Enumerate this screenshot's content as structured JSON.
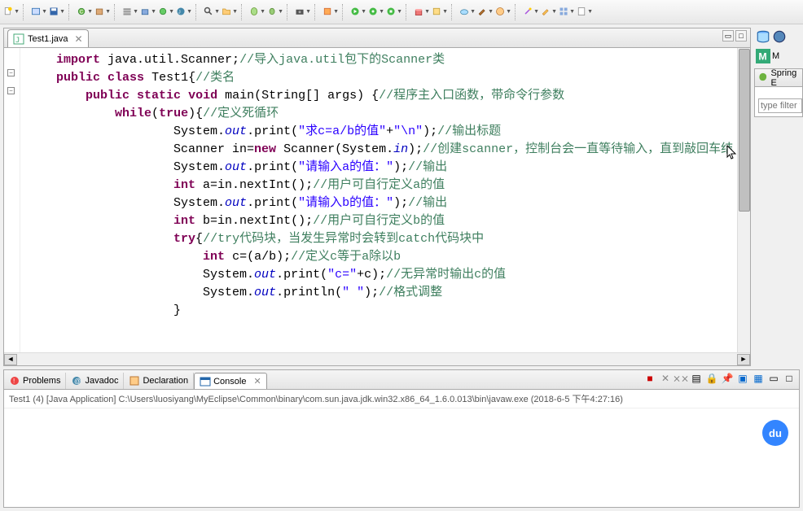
{
  "toolbar": {
    "groups": [
      [
        "new-icon"
      ],
      [
        "open-type-icon",
        "save-icon"
      ],
      [
        "new-class-icon",
        "new-package-icon"
      ],
      [
        "servers-icon",
        "deploy-icon",
        "publish-icon",
        "jsp-icon"
      ],
      [
        "search-icon",
        "folder-icon"
      ],
      [
        "new-bean-icon",
        "bean-icon"
      ],
      [
        "camera-icon"
      ],
      [
        "paint-icon"
      ],
      [
        "run-icon",
        "debug-icon",
        "external-icon"
      ],
      [
        "gift-icon",
        "task-icon"
      ],
      [
        "cloud-icon",
        "brush-icon",
        "palette-icon"
      ],
      [
        "wand-icon",
        "pencil-icon",
        "grid-icon",
        "doc-icon"
      ]
    ]
  },
  "editor": {
    "tab_label": "Test1.java",
    "tab_icon": "java-file-icon"
  },
  "code": {
    "lines": [
      {
        "indent": 1,
        "tokens": [
          {
            "t": "kw",
            "s": "import"
          },
          {
            "t": "p",
            "s": " java.util.Scanner;"
          },
          {
            "t": "com",
            "s": "//导入java.util包下的Scanner类"
          }
        ]
      },
      {
        "indent": 1,
        "tokens": [
          {
            "t": "kw",
            "s": "public"
          },
          {
            "t": "p",
            "s": " "
          },
          {
            "t": "kw",
            "s": "class"
          },
          {
            "t": "p",
            "s": " Test1{"
          },
          {
            "t": "com",
            "s": "//类名"
          }
        ]
      },
      {
        "indent": 2,
        "tokens": [
          {
            "t": "kw",
            "s": "public"
          },
          {
            "t": "p",
            "s": " "
          },
          {
            "t": "kw",
            "s": "static"
          },
          {
            "t": "p",
            "s": " "
          },
          {
            "t": "kw",
            "s": "void"
          },
          {
            "t": "p",
            "s": " main(String[] args) {"
          },
          {
            "t": "com",
            "s": "//程序主入口函数，带命令行参数"
          }
        ]
      },
      {
        "indent": 3,
        "tokens": [
          {
            "t": "kw",
            "s": "while"
          },
          {
            "t": "p",
            "s": "("
          },
          {
            "t": "kw",
            "s": "true"
          },
          {
            "t": "p",
            "s": "){"
          },
          {
            "t": "com",
            "s": "//定义死循环"
          }
        ]
      },
      {
        "indent": 5,
        "tokens": [
          {
            "t": "p",
            "s": "System."
          },
          {
            "t": "fld",
            "s": "out"
          },
          {
            "t": "p",
            "s": ".print("
          },
          {
            "t": "str",
            "s": "\"求c=a/b的值\""
          },
          {
            "t": "p",
            "s": "+"
          },
          {
            "t": "str",
            "s": "\"\\n\""
          },
          {
            "t": "p",
            "s": ");"
          },
          {
            "t": "com",
            "s": "//输出标题"
          }
        ]
      },
      {
        "indent": 5,
        "tokens": [
          {
            "t": "p",
            "s": "Scanner in="
          },
          {
            "t": "kw",
            "s": "new"
          },
          {
            "t": "p",
            "s": " Scanner(System."
          },
          {
            "t": "fld",
            "s": "in"
          },
          {
            "t": "p",
            "s": ");"
          },
          {
            "t": "com",
            "s": "//创建scanner，控制台会一直等待输入，直到敲回车结"
          }
        ]
      },
      {
        "indent": 5,
        "tokens": [
          {
            "t": "p",
            "s": "System."
          },
          {
            "t": "fld",
            "s": "out"
          },
          {
            "t": "p",
            "s": ".print("
          },
          {
            "t": "str",
            "s": "\"请输入a的值：\""
          },
          {
            "t": "p",
            "s": ");"
          },
          {
            "t": "com",
            "s": "//输出"
          }
        ]
      },
      {
        "indent": 5,
        "tokens": [
          {
            "t": "kw",
            "s": "int"
          },
          {
            "t": "p",
            "s": " a=in.nextInt();"
          },
          {
            "t": "com",
            "s": "//用户可自行定义a的值"
          }
        ]
      },
      {
        "indent": 5,
        "tokens": [
          {
            "t": "p",
            "s": "System."
          },
          {
            "t": "fld",
            "s": "out"
          },
          {
            "t": "p",
            "s": ".print("
          },
          {
            "t": "str",
            "s": "\"请输入b的值：\""
          },
          {
            "t": "p",
            "s": ");"
          },
          {
            "t": "com",
            "s": "//输出"
          }
        ]
      },
      {
        "indent": 5,
        "tokens": [
          {
            "t": "kw",
            "s": "int"
          },
          {
            "t": "p",
            "s": " b=in.nextInt();"
          },
          {
            "t": "com",
            "s": "//用户可自行定义b的值"
          }
        ]
      },
      {
        "indent": 5,
        "tokens": [
          {
            "t": "kw",
            "s": "try"
          },
          {
            "t": "p",
            "s": "{"
          },
          {
            "t": "com",
            "s": "//try代码块，当发生异常时会转到catch代码块中"
          }
        ]
      },
      {
        "indent": 6,
        "tokens": [
          {
            "t": "kw",
            "s": "int"
          },
          {
            "t": "p",
            "s": " c=(a/b);"
          },
          {
            "t": "com",
            "s": "//定义c等于a除以b"
          }
        ]
      },
      {
        "indent": 6,
        "tokens": [
          {
            "t": "p",
            "s": "System."
          },
          {
            "t": "fld",
            "s": "out"
          },
          {
            "t": "p",
            "s": ".print("
          },
          {
            "t": "str",
            "s": "\"c=\""
          },
          {
            "t": "p",
            "s": "+c);"
          },
          {
            "t": "com",
            "s": "//无异常时输出c的值"
          }
        ]
      },
      {
        "indent": 6,
        "tokens": [
          {
            "t": "p",
            "s": "System."
          },
          {
            "t": "fld",
            "s": "out"
          },
          {
            "t": "p",
            "s": ".println("
          },
          {
            "t": "str",
            "s": "\" \""
          },
          {
            "t": "p",
            "s": ");"
          },
          {
            "t": "com",
            "s": "//格式调整"
          }
        ]
      },
      {
        "indent": 5,
        "tokens": [
          {
            "t": "p",
            "s": "}"
          }
        ]
      }
    ]
  },
  "right": {
    "spring_label": "Spring E",
    "filter_placeholder": "type filter t"
  },
  "bottom": {
    "tabs": [
      {
        "icon": "problems-icon",
        "label": "Problems"
      },
      {
        "icon": "javadoc-icon",
        "label": "Javadoc"
      },
      {
        "icon": "declaration-icon",
        "label": "Declaration"
      },
      {
        "icon": "console-icon",
        "label": "Console"
      }
    ],
    "console_info": "Test1 (4) [Java Application] C:\\Users\\luosiyang\\MyEclipse\\Common\\binary\\com.sun.java.jdk.win32.x86_64_1.6.0.013\\bin\\javaw.exe (2018-6-5 下午4:27:16)"
  },
  "baidu_label": "du",
  "right_icons_top": [
    "db-icon",
    "myeclipse-icon",
    "m-icon"
  ],
  "m_label": "M"
}
